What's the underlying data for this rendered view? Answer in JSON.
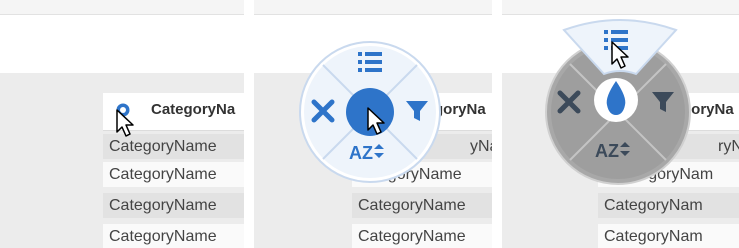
{
  "column": {
    "header": "CategoryNa",
    "header_panel2": "goryNa",
    "header_panel3": "goryNa",
    "rows": [
      "CategoryName",
      "CategoryName",
      "CategoryName",
      "CategoryName"
    ],
    "rows_panel2": [
      "yName",
      "gegoryName",
      "CategoryName",
      "CategoryName"
    ],
    "rows_panel3": [
      "ryNam",
      "categoryNam",
      "CategoryNam",
      "CategoryNam"
    ]
  },
  "menu": {
    "list_icon": "list-icon",
    "clear_icon": "close-icon",
    "filter_icon": "filter-icon",
    "center_icon": "drop-icon",
    "sort_label": "AZ"
  },
  "colors": {
    "accent": "#2e74c9",
    "menu_light": "#e8f0fa",
    "menu_dark": "#a8a8a8"
  }
}
